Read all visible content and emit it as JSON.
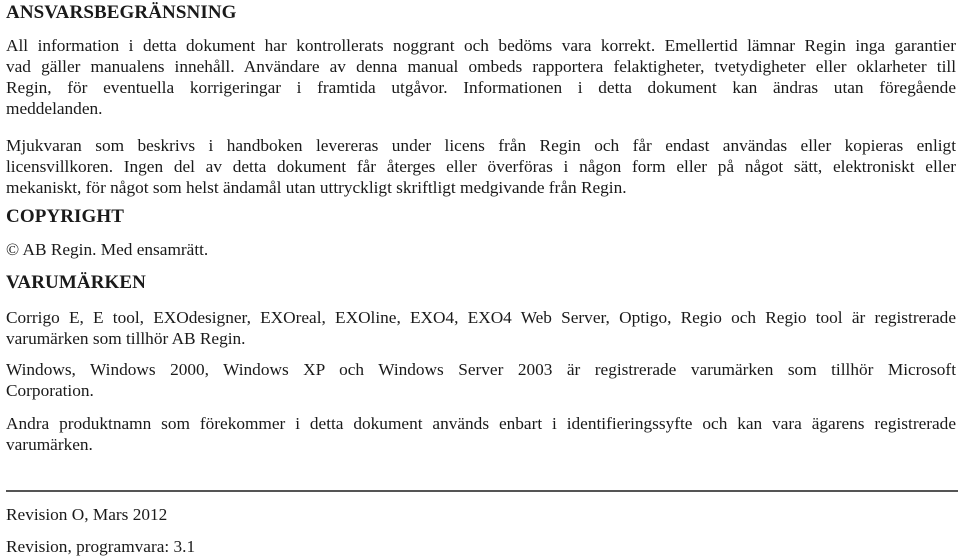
{
  "sections": {
    "disclaimer": {
      "heading": "ANSVARSBEGRÄNSNING",
      "para1": {
        "lines": [
          "All information i detta dokument har kontrollerats noggrant och bedöms vara korrekt. Emellertid lämnar Regin inga garantier",
          "vad gäller manualens innehåll. Användare av denna manual ombeds rapportera felaktigheter, tvetydigheter eller oklarheter till",
          "Regin, för eventuella korrigeringar i framtida utgåvor. Informationen i detta dokument kan ändras utan föregående",
          "meddelanden."
        ]
      },
      "para2": {
        "lines": [
          "Mjukvaran som beskrivs i handboken levereras under licens från Regin och får endast användas eller kopieras enligt",
          "licensvillkoren. Ingen del av detta dokument får återges eller överföras i någon form eller på något sätt, elektroniskt eller",
          "mekaniskt, för något som helst ändamål utan uttryckligt skriftligt medgivande från Regin."
        ]
      }
    },
    "copyright": {
      "heading": "COPYRIGHT",
      "text": "© AB Regin. Med ensamrätt."
    },
    "trademarks": {
      "heading": "VARUMÄRKEN",
      "para1": {
        "lines": [
          "Corrigo E, E tool, EXOdesigner, EXOreal, EXOline, EXO4, EXO4 Web Server, Optigo, Regio och Regio tool är registrerade",
          "varumärken som tillhör AB Regin."
        ]
      },
      "para2": {
        "lines": [
          "Windows, Windows 2000, Windows XP och Windows Server 2003 är registrerade varumärken som tillhör Microsoft",
          "Corporation."
        ]
      },
      "para3": {
        "lines": [
          "Andra produktnamn som förekommer i detta dokument används enbart i identifieringssyfte och kan vara ägarens registrerade",
          "varumärken."
        ]
      }
    }
  },
  "footer": {
    "revision": "Revision O, Mars 2012",
    "software_revision": "Revision, programvara: 3.1"
  }
}
